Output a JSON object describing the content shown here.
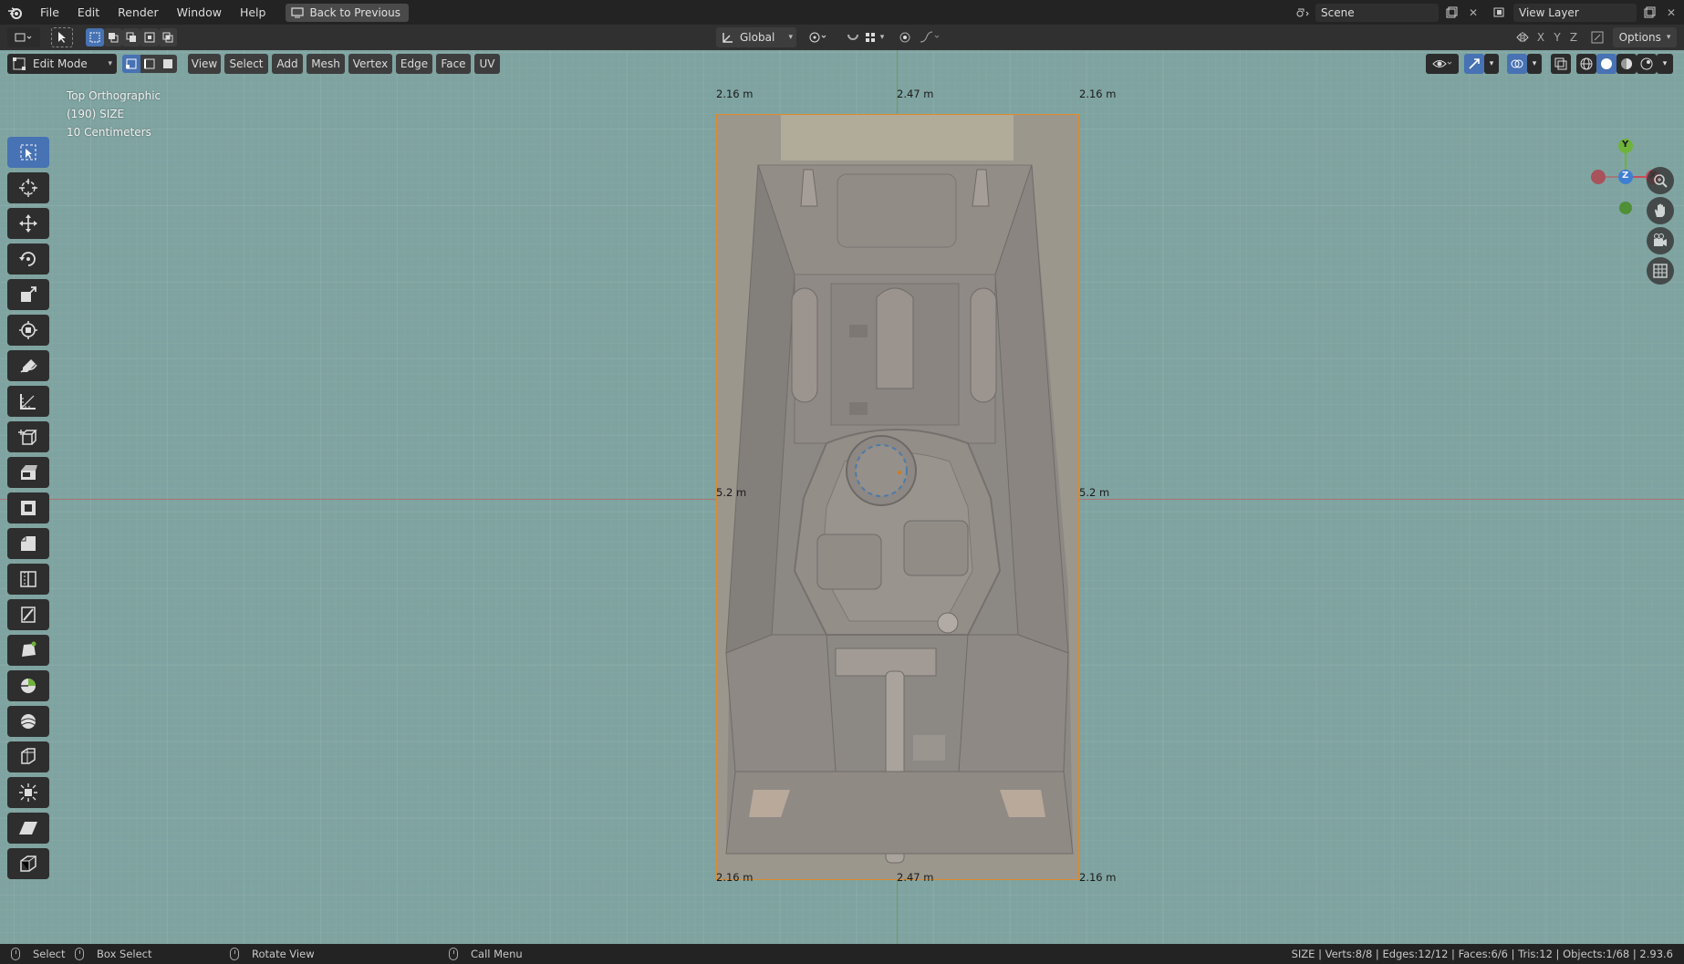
{
  "menubar": {
    "items": [
      "File",
      "Edit",
      "Render",
      "Window",
      "Help"
    ],
    "back_button": "Back to Previous",
    "scene": "Scene",
    "view_layer": "View Layer"
  },
  "header": {
    "orientation": "Global",
    "options": "Options",
    "axis_x": "X",
    "axis_y": "Y",
    "axis_z": "Z"
  },
  "editor": {
    "mode": "Edit Mode",
    "menus": [
      "View",
      "Select",
      "Add",
      "Mesh",
      "Vertex",
      "Edge",
      "Face",
      "UV"
    ]
  },
  "viewport": {
    "view_name": "Top Orthographic",
    "object_info": "(190) SIZE",
    "grid_scale": "10 Centimeters",
    "dimensions": {
      "top_left": "2.16 m",
      "top_center": "2.47 m",
      "top_right": "2.16 m",
      "mid_left": "5.2 m",
      "mid_right": "5.2 m",
      "bottom_left": "2.16 m",
      "bottom_center": "2.47 m",
      "bottom_right": "2.16 m"
    },
    "gizmo": {
      "y": "Y",
      "z": "Z",
      "x": "X"
    }
  },
  "toolbar": {
    "tools": [
      "select-box-icon",
      "cursor-icon",
      "move-icon",
      "rotate-icon",
      "scale-icon",
      "transform-icon",
      "annotate-icon",
      "measure-icon",
      "add-cube-icon",
      "extrude-icon",
      "inset-icon",
      "bevel-icon",
      "loop-cut-icon",
      "knife-icon",
      "poly-build-icon",
      "spin-icon",
      "smooth-icon",
      "edge-slide-icon",
      "shrink-fatten-icon",
      "shear-icon",
      "rip-icon"
    ]
  },
  "statusbar": {
    "select": "Select",
    "box_select": "Box Select",
    "rotate_view": "Rotate View",
    "call_menu": "Call Menu",
    "stats": "SIZE | Verts:8/8 | Edges:12/12 | Faces:6/6 | Tris:12 | Objects:1/68 | 2.93.6"
  },
  "colors": {
    "viewport_bg": "#7ea3a0",
    "accent": "#4772b3",
    "selection": "#e08a2a",
    "axis_x": "#c94d5a",
    "axis_y": "#6fb33b",
    "axis_z": "#3f7fd1"
  }
}
